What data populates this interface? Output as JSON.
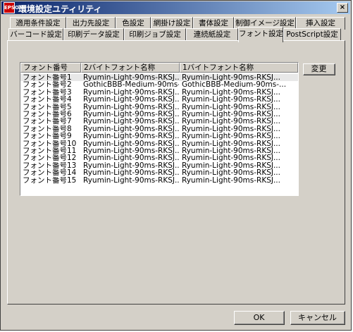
{
  "window": {
    "title": "環境設定ユティリティ",
    "icon_text": "EPSON",
    "close_label": "×"
  },
  "tabs_row1": [
    {
      "label": "適用条件設定"
    },
    {
      "label": "出力先設定"
    },
    {
      "label": "色設定"
    },
    {
      "label": "網掛け設定"
    },
    {
      "label": "書体設定"
    },
    {
      "label": "制御イメージ設定"
    },
    {
      "label": "挿入設定"
    }
  ],
  "tabs_row2": [
    {
      "label": "バーコード設定"
    },
    {
      "label": "印刷データ設定"
    },
    {
      "label": "印刷ジョブ設定"
    },
    {
      "label": "連続紙設定"
    },
    {
      "label": "フォント設定"
    },
    {
      "label": "PostScript設定"
    }
  ],
  "active_tab": "フォント設定",
  "font_list": {
    "columns": [
      "フォント番号",
      "2バイトフォント名称",
      "1バイトフォント名称"
    ],
    "rows": [
      [
        "フォント番号1",
        "Ryumin-Light-90ms-RKSJ...",
        "Ryumin-Light-90ms-RKSJ..."
      ],
      [
        "フォント番号2",
        "GothicBBB-Medium-90ms-...",
        "GothicBBB-Medium-90ms-..."
      ],
      [
        "フォント番号3",
        "Ryumin-Light-90ms-RKSJ...",
        "Ryumin-Light-90ms-RKSJ..."
      ],
      [
        "フォント番号4",
        "Ryumin-Light-90ms-RKSJ...",
        "Ryumin-Light-90ms-RKSJ..."
      ],
      [
        "フォント番号5",
        "Ryumin-Light-90ms-RKSJ...",
        "Ryumin-Light-90ms-RKSJ..."
      ],
      [
        "フォント番号6",
        "Ryumin-Light-90ms-RKSJ...",
        "Ryumin-Light-90ms-RKSJ..."
      ],
      [
        "フォント番号7",
        "Ryumin-Light-90ms-RKSJ...",
        "Ryumin-Light-90ms-RKSJ..."
      ],
      [
        "フォント番号8",
        "Ryumin-Light-90ms-RKSJ...",
        "Ryumin-Light-90ms-RKSJ..."
      ],
      [
        "フォント番号9",
        "Ryumin-Light-90ms-RKSJ...",
        "Ryumin-Light-90ms-RKSJ..."
      ],
      [
        "フォント番号10",
        "Ryumin-Light-90ms-RKSJ...",
        "Ryumin-Light-90ms-RKSJ..."
      ],
      [
        "フォント番号11",
        "Ryumin-Light-90ms-RKSJ...",
        "Ryumin-Light-90ms-RKSJ..."
      ],
      [
        "フォント番号12",
        "Ryumin-Light-90ms-RKSJ...",
        "Ryumin-Light-90ms-RKSJ..."
      ],
      [
        "フォント番号13",
        "Ryumin-Light-90ms-RKSJ...",
        "Ryumin-Light-90ms-RKSJ..."
      ],
      [
        "フォント番号14",
        "Ryumin-Light-90ms-RKSJ...",
        "Ryumin-Light-90ms-RKSJ..."
      ],
      [
        "フォント番号15",
        "Ryumin-Light-90ms-RKSJ...",
        "Ryumin-Light-90ms-RKSJ..."
      ]
    ],
    "selected_row": 0
  },
  "buttons": {
    "change": "変更",
    "ok": "OK",
    "cancel": "キャンセル"
  }
}
